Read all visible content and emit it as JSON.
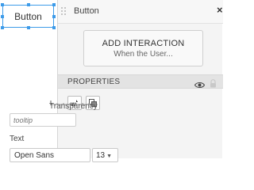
{
  "canvas": {
    "widget_label": "Button"
  },
  "panel": {
    "title": "Button",
    "close_glyph": "×",
    "add_interaction": {
      "label": "ADD INTERACTION",
      "sublabel": "When the User..."
    },
    "properties": {
      "header": "PROPERTIES",
      "transparency_label": "Transparency",
      "tooltip_placeholder": "tooltip",
      "text_section_label": "Text",
      "font_family_value": "Open Sans",
      "font_size_value": "13"
    }
  },
  "colors": {
    "selection_blue": "#3d9be9",
    "panel_bg": "#f4f4f4",
    "section_header_bg": "#e3e3e3"
  },
  "icons": {
    "drag": "drag-grip-icon",
    "close": "close-icon",
    "visibility": "eye-icon",
    "lock": "lock-icon",
    "widget_style": "widget-style-icon",
    "copy_style": "copy-style-icon",
    "size_caret": "caret-down-icon"
  }
}
